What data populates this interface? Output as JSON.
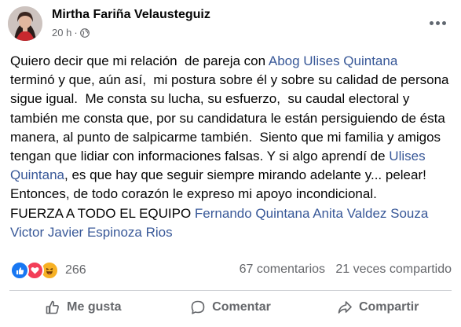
{
  "post": {
    "author": "Mirtha Fariña Velausteguiz",
    "time": "20 h",
    "separator": "·",
    "privacy_icon": "globe-icon",
    "text_segments": [
      "Quiero decir que mi relación  de pareja con ",
      "Abog Ulises Quintana",
      "\nterminó y que, aún así,  mi postura sobre él y sobre su calidad de persona sigue igual.  Me consta su lucha, su esfuerzo,  su caudal electoral y también me consta que, por su candidatura le están persiguiendo de ésta manera, al punto de salpicarme también.  Siento que mi familia y amigos tengan que lidiar con informaciones falsas. Y si algo aprendí de ",
      "Ulises Quintana",
      ", es que hay que seguir siempre mirando adelante y... pelear!\nEntonces, de todo corazón le expreso mi apoyo incondicional.\nFUERZA A TODO EL EQUIPO ",
      "Fernando Quintana",
      " ",
      "Anita Valdez Souza",
      "\n",
      "Victor Javier Espinoza Rios"
    ]
  },
  "stats": {
    "reaction_count": "266",
    "reaction_icons": [
      "like-icon",
      "love-icon",
      "haha-icon"
    ],
    "comments": "67 comentarios",
    "shares": "21 veces compartido"
  },
  "actions": {
    "like": "Me gusta",
    "comment": "Comentar",
    "share": "Compartir"
  },
  "colors": {
    "link": "#385898",
    "secondary_text": "#65676b",
    "like_blue": "#1877f2",
    "love_red": "#f33e58",
    "haha_yellow": "#f7b125"
  }
}
